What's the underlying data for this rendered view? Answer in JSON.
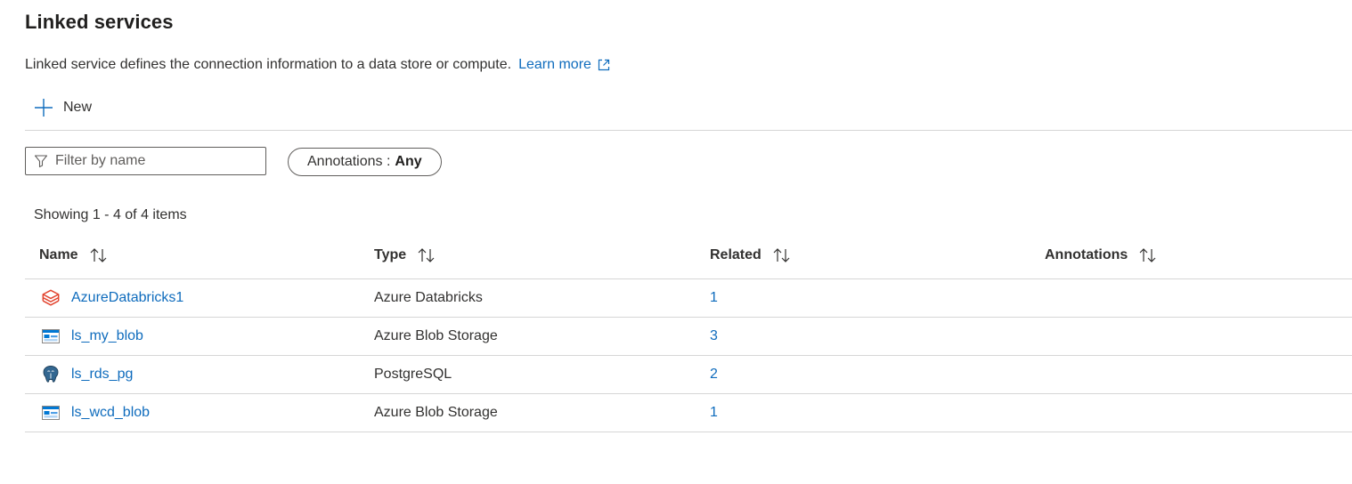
{
  "header": {
    "title": "Linked services",
    "description": "Linked service defines the connection information to a data store or compute.",
    "learn_more": "Learn more"
  },
  "toolbar": {
    "new_label": "New"
  },
  "filter": {
    "placeholder": "Filter by name",
    "value": ""
  },
  "annotations_filter": {
    "label": "Annotations :",
    "value": "Any"
  },
  "list": {
    "count_text": "Showing 1 - 4 of 4 items",
    "columns": {
      "name": "Name",
      "type": "Type",
      "related": "Related",
      "annotations": "Annotations"
    },
    "rows": [
      {
        "name": "AzureDatabricks1",
        "type": "Azure Databricks",
        "related": "1",
        "annotations": "",
        "icon": "databricks-icon"
      },
      {
        "name": "ls_my_blob",
        "type": "Azure Blob Storage",
        "related": "3",
        "annotations": "",
        "icon": "blob-storage-icon"
      },
      {
        "name": "ls_rds_pg",
        "type": "PostgreSQL",
        "related": "2",
        "annotations": "",
        "icon": "postgresql-icon"
      },
      {
        "name": "ls_wcd_blob",
        "type": "Azure Blob Storage",
        "related": "1",
        "annotations": "",
        "icon": "blob-storage-icon"
      }
    ]
  },
  "colors": {
    "link": "#0f6cbd",
    "text": "#323130",
    "border": "#d6d6d6",
    "databricks": "#e2442f",
    "blob": "#0078d4"
  }
}
